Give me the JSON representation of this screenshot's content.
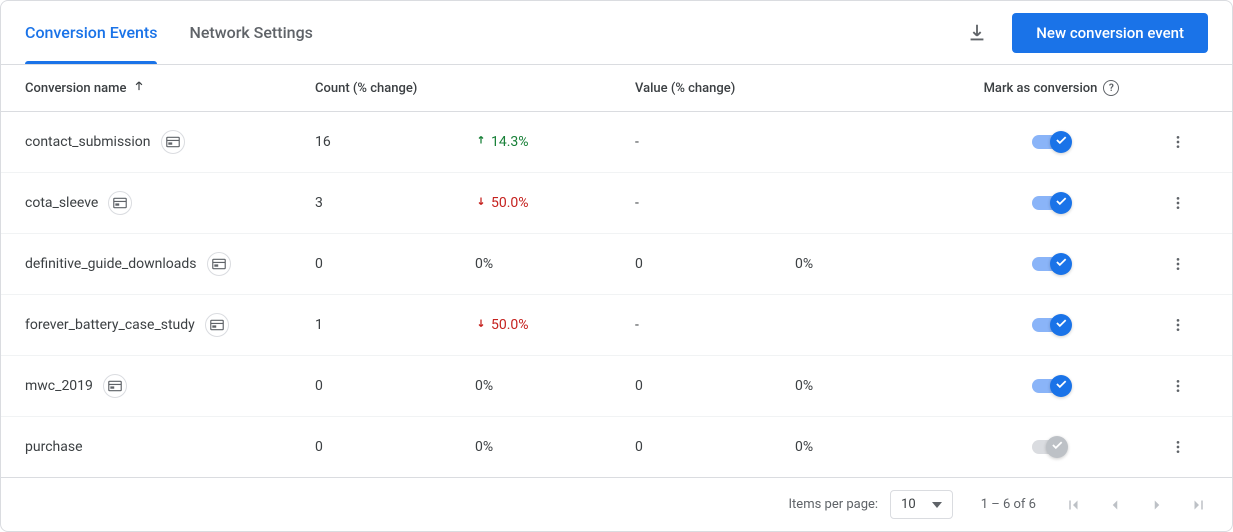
{
  "tabs": {
    "active": "Conversion Events",
    "other": "Network Settings"
  },
  "actions": {
    "new_event": "New conversion event"
  },
  "columns": {
    "name": "Conversion name",
    "count": "Count (% change)",
    "value": "Value (% change)",
    "mark": "Mark as conversion"
  },
  "rows": [
    {
      "name": "contact_submission",
      "badge": true,
      "count": "16",
      "change": "14.3%",
      "change_dir": "up",
      "value": "-",
      "value_change": "",
      "toggle": true
    },
    {
      "name": "cota_sleeve",
      "badge": true,
      "count": "3",
      "change": "50.0%",
      "change_dir": "down",
      "value": "-",
      "value_change": "",
      "toggle": true
    },
    {
      "name": "definitive_guide_downloads",
      "badge": true,
      "count": "0",
      "change": "0%",
      "change_dir": "none",
      "value": "0",
      "value_change": "0%",
      "toggle": true
    },
    {
      "name": "forever_battery_case_study",
      "badge": true,
      "count": "1",
      "change": "50.0%",
      "change_dir": "down",
      "value": "-",
      "value_change": "",
      "toggle": true
    },
    {
      "name": "mwc_2019",
      "badge": true,
      "count": "0",
      "change": "0%",
      "change_dir": "none",
      "value": "0",
      "value_change": "0%",
      "toggle": true
    },
    {
      "name": "purchase",
      "badge": false,
      "count": "0",
      "change": "0%",
      "change_dir": "none",
      "value": "0",
      "value_change": "0%",
      "toggle": false
    }
  ],
  "footer": {
    "items_label": "Items per page:",
    "page_size": "10",
    "range": "1 – 6 of 6"
  }
}
